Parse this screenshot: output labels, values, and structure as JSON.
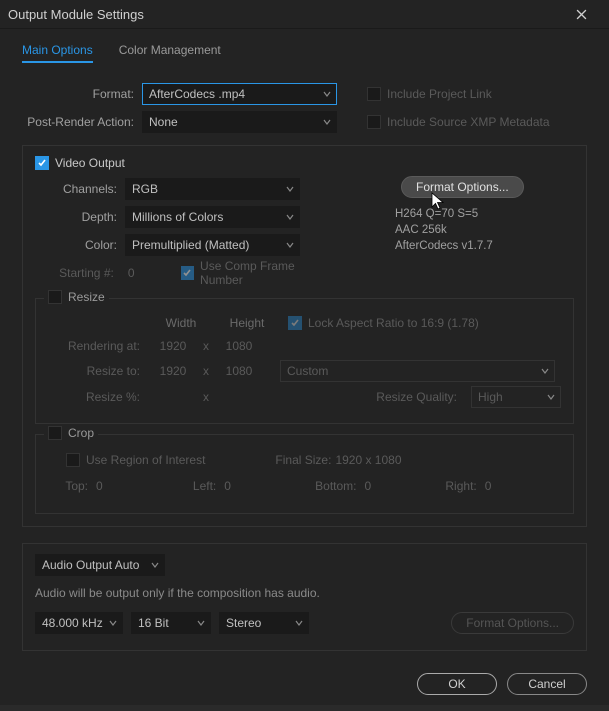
{
  "window": {
    "title": "Output Module Settings"
  },
  "tabs": {
    "main": "Main Options",
    "color": "Color Management"
  },
  "top": {
    "format_label": "Format:",
    "format_value": "AfterCodecs .mp4",
    "action_label": "Post-Render Action:",
    "action_value": "None",
    "include_link": "Include Project Link",
    "include_xmp": "Include Source XMP Metadata"
  },
  "video": {
    "header": "Video Output",
    "channels_label": "Channels:",
    "channels_value": "RGB",
    "depth_label": "Depth:",
    "depth_value": "Millions of Colors",
    "color_label": "Color:",
    "color_value": "Premultiplied (Matted)",
    "start_label": "Starting #:",
    "start_value": "0",
    "use_comp": "Use Comp Frame Number",
    "format_options": "Format Options...",
    "codec_line1": "H264 Q=70 S=5",
    "codec_line2": "AAC 256k",
    "codec_line3": "AfterCodecs v1.7.7"
  },
  "resize": {
    "header": "Resize",
    "width": "Width",
    "height": "Height",
    "lock": "Lock Aspect Ratio to 16:9 (1.78)",
    "rendering_at": "Rendering at:",
    "resize_to": "Resize to:",
    "resize_pct": "Resize %:",
    "w": "1920",
    "x": "x",
    "h": "1080",
    "custom": "Custom",
    "quality_label": "Resize Quality:",
    "quality_value": "High"
  },
  "crop": {
    "header": "Crop",
    "use_region": "Use Region of Interest",
    "final_size_label": "Final Size:",
    "final_size_value": "1920 x 1080",
    "top": "Top:",
    "left": "Left:",
    "bottom": "Bottom:",
    "right": "Right:",
    "zero": "0"
  },
  "audio": {
    "mode": "Audio Output Auto",
    "note": "Audio will be output only if the composition has audio.",
    "rate": "48.000 kHz",
    "bit": "16 Bit",
    "ch": "Stereo",
    "format_options": "Format Options..."
  },
  "footer": {
    "ok": "OK",
    "cancel": "Cancel"
  }
}
